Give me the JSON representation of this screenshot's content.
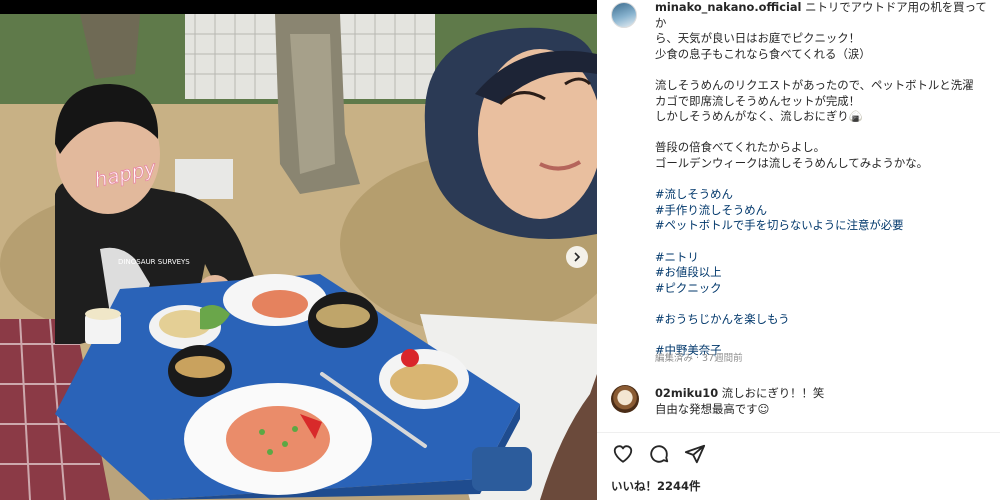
{
  "post": {
    "username": "minako_nakano.official",
    "caption_lines": [
      "ニトリでアウトドア用の机を買ってか",
      "ら、天気が良い日はお庭でピクニック！",
      "少食の息子もこれなら食べてくれる（涙）",
      "",
      "流しそうめんのリクエストがあったので、ペットボトルと洗濯",
      "カゴで即席流しそうめんセットが完成！",
      "しかしそうめんがなく、流しおにぎり🍙",
      "",
      "普段の倍食べてくれたからよし。",
      "ゴールデンウィークは流しそうめんしてみようかな。"
    ],
    "hashtag_groups": [
      [
        "#流しそうめん",
        "#手作り流しそうめん",
        "#ペットボトルで手を切らないように注意が必要"
      ],
      [
        "#ニトリ",
        "#お値段以上",
        "#ピクニック"
      ],
      [
        "#おうちじかんを楽しもう"
      ],
      [
        "#中野美奈子"
      ]
    ],
    "meta": "編集済み · 37週間前"
  },
  "photo": {
    "sticker_text": "happy",
    "shirt_text": "DINOSAUR SURVEYS"
  },
  "comment": {
    "username": "02miku10",
    "line1": "流しおにぎり！！笑",
    "line2": "自由な発想最高です☺"
  },
  "actions": {
    "like_icon": "heart-icon",
    "comment_icon": "comment-icon",
    "share_icon": "share-icon",
    "next_icon": "chevron-right-icon"
  },
  "likes": {
    "text": "いいね！2244件"
  },
  "colors": {
    "text": "#262626",
    "hashtag": "#00376b",
    "muted": "#8e8e8e",
    "table": "#2a63b8"
  }
}
